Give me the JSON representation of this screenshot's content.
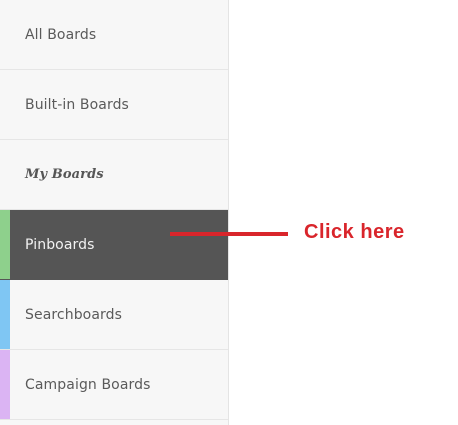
{
  "sidebar": {
    "items": [
      {
        "label": "All Boards"
      },
      {
        "label": "Built-in Boards"
      },
      {
        "label": "My Boards"
      },
      {
        "label": "Pinboards",
        "accent_color": "#8ed08c"
      },
      {
        "label": "Searchboards",
        "accent_color": "#7fc6f3"
      },
      {
        "label": "Campaign Boards",
        "accent_color": "#dbb4f3"
      }
    ]
  },
  "annotation": {
    "text": "Click here",
    "color": "#d9252b"
  },
  "colors": {
    "active_background": "#555555",
    "sidebar_background": "#f7f7f7"
  }
}
